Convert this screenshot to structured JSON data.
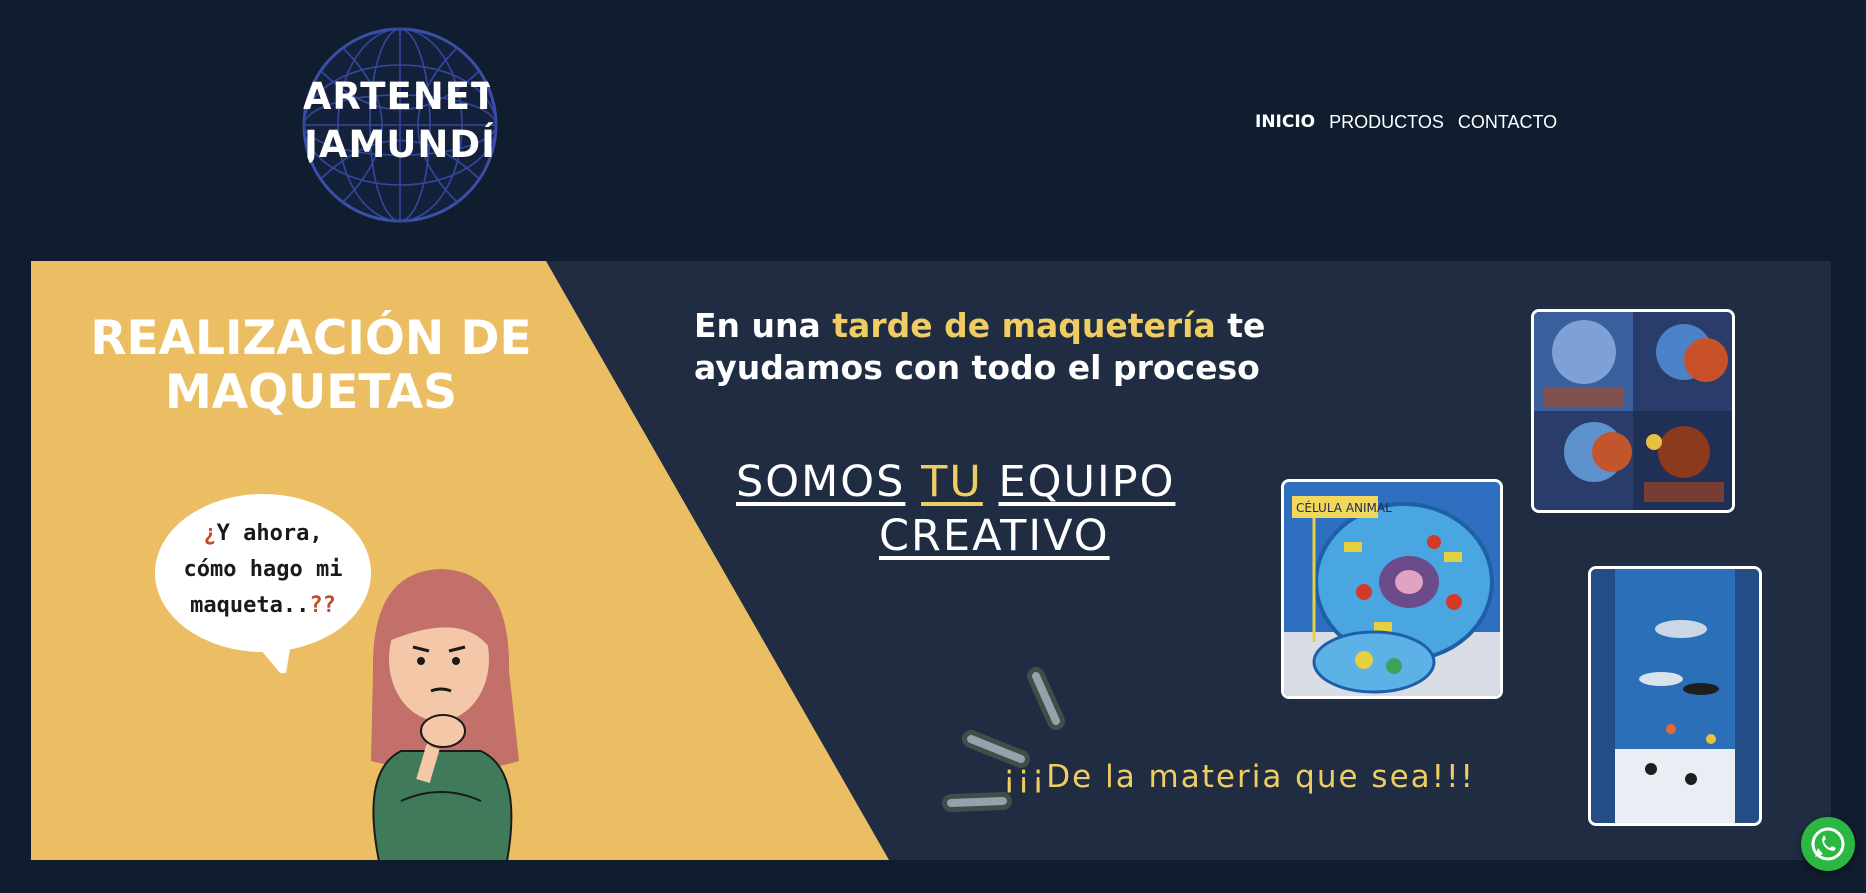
{
  "header": {
    "logo": {
      "line1": "ARTENET",
      "line2": "JAMUNDÍ",
      "icon": "globe-icon"
    },
    "nav": [
      {
        "label": "INICIO",
        "active": true
      },
      {
        "label": "PRODUCTOS",
        "active": false
      },
      {
        "label": "CONTACTO",
        "active": false
      }
    ]
  },
  "banner": {
    "title_line1": "REALIZACIÓN DE",
    "title_line2": "MAQUETAS",
    "bubble": {
      "line1_mark": "¿",
      "line1_text": "Y ahora,",
      "line2": "cómo hago mi",
      "line3_text": "maqueta..",
      "line3_mark": "??"
    },
    "tagline": {
      "part1": "En una ",
      "highlight": "tarde de maquetería",
      "part2": " te",
      "line2": "ayudamos con todo el proceso"
    },
    "team": {
      "word1": "SOMOS",
      "word2": "TU",
      "word3": "EQUIPO",
      "line2": "CREATIVO"
    },
    "slogan": "¡¡¡De la materia que sea!!!",
    "photo_cell_label": "CÉLULA ANIMAL"
  },
  "colors": {
    "page_bg": "#101d2e",
    "banner_bg": "#1f2c42",
    "yellow_panel": "#ecbe63",
    "accent_yellow": "#efcd63",
    "whatsapp_green": "#2bb741"
  },
  "floating": {
    "icon": "whatsapp-icon"
  }
}
